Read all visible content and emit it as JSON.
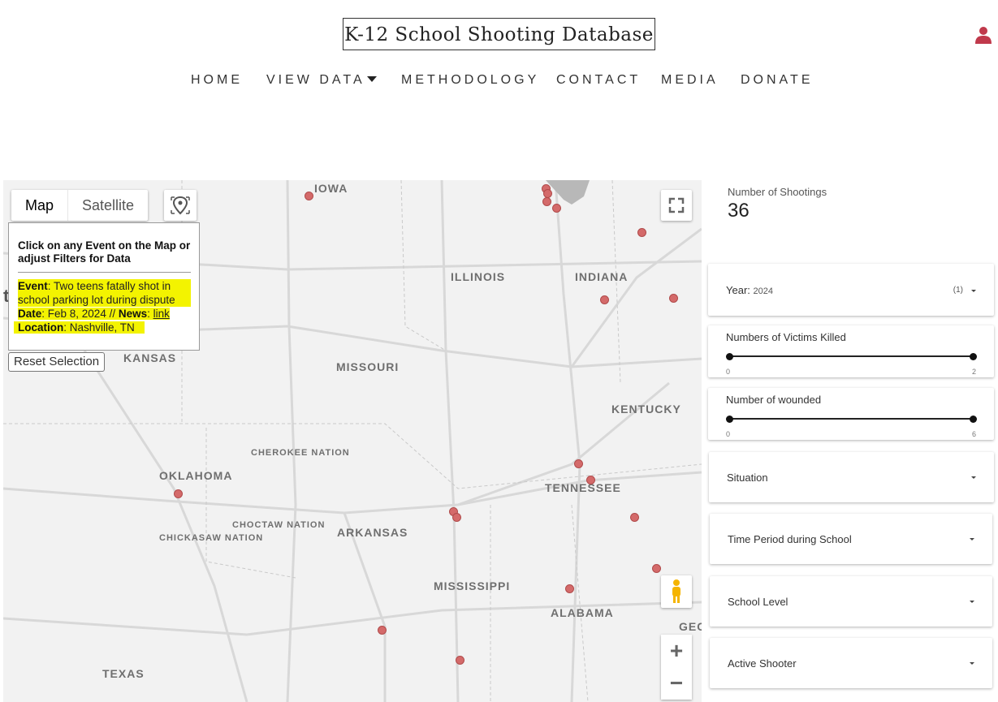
{
  "site": {
    "title": "K-12 School Shooting Database"
  },
  "nav": {
    "home": "HOME",
    "view_data": "VIEW DATA",
    "methodology": "METHODOLOGY",
    "contact": "CONTACT",
    "media": "MEDIA",
    "donate": "DONATE"
  },
  "map": {
    "map_tab": "Map",
    "satellite_tab": "Satellite",
    "info": {
      "heading": "Click on any Event on the Map or adjust Filters for Data",
      "event_label": "Event",
      "event_value": ": Two teens fatally shot in school parking lot during dispute",
      "date_label": "Date",
      "date_value": ": Feb 8, 2024 // ",
      "news_label": "News",
      "news_sep": ": ",
      "news_link": "link",
      "location_label": "Location",
      "location_value": ": Nashville, TN"
    },
    "reset_button": "Reset Selection",
    "labels": {
      "iowa": "IOWA",
      "illinois": "ILLINOIS",
      "indiana": "INDIANA",
      "kansas": "KANSAS",
      "missouri": "MISSOURI",
      "kentucky": "KENTUCKY",
      "cherokee": "CHEROKEE NATION",
      "oklahoma": "OKLAHOMA",
      "tennessee": "TENNESSEE",
      "chickasaw": "CHICKASAW NATION",
      "choctaw": "CHOCTAW NATION",
      "arkansas": "ARKANSAS",
      "mississippi": "MISSISSIPPI",
      "alabama": "ALABAMA",
      "texas": "TEXAS",
      "geo_partial": "GEC",
      "left_partial": "t"
    },
    "marker_color": "#d46a6a"
  },
  "filters": {
    "count_label": "Number of Shootings",
    "count_value": "36",
    "year_label": "Year: ",
    "year_value": "2024",
    "year_count": "(1)",
    "killed_label": "Numbers of Victims Killed",
    "killed_min": "0",
    "killed_max": "2",
    "wounded_label": "Number of wounded",
    "wounded_min": "0",
    "wounded_max": "6",
    "situation": "Situation",
    "time_period": "Time Period during School",
    "school_level": "School Level",
    "active_shooter": "Active Shooter"
  },
  "colors": {
    "accent": "#c0394b",
    "highlight": "#f3f300"
  }
}
